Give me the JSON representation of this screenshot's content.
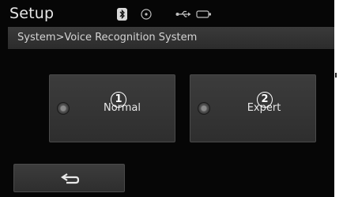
{
  "header": {
    "title": "Setup",
    "status_icons": [
      "bluetooth-icon",
      "disc-icon",
      "usb-icon",
      "battery-icon"
    ]
  },
  "breadcrumb": "System>Voice Recognition System",
  "options": [
    {
      "label": "Normal",
      "callout": "1",
      "selected": false
    },
    {
      "label": "Expert",
      "callout": "2",
      "selected": false
    }
  ],
  "footer": {
    "back_icon": "back-arrow-icon"
  },
  "colors": {
    "background": "#060606",
    "panel": "#353535",
    "text": "#e6e6e6"
  }
}
